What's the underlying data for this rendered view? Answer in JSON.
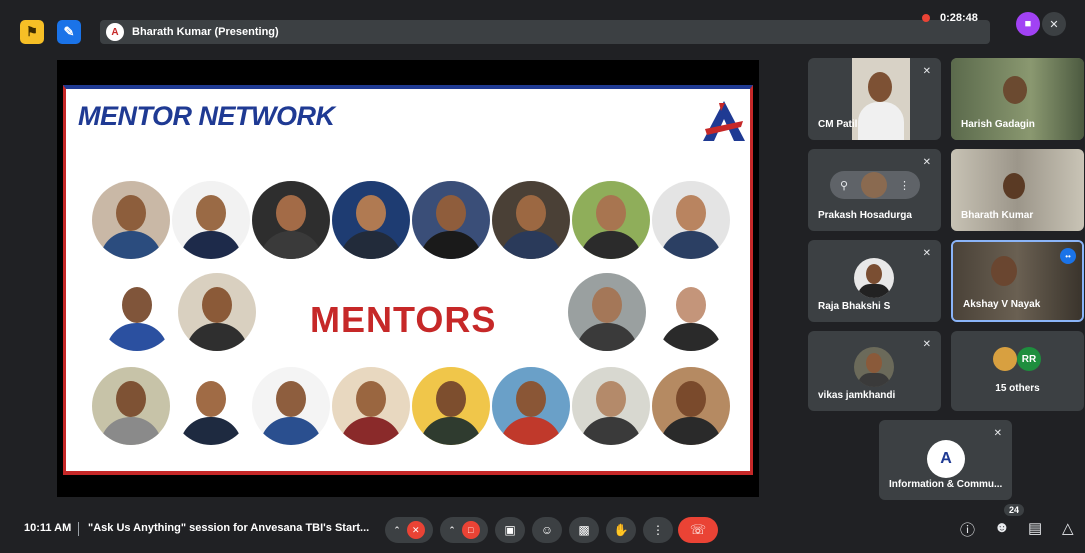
{
  "topbar": {
    "presenter_label": "Bharath Kumar (Presenting)",
    "presenter_avatar_letter": "A",
    "recording_time": "0:28:48"
  },
  "slide": {
    "title": "MENTOR NETWORK",
    "center_text": "MENTORS",
    "title_color": "#1f3a93",
    "accent_color": "#c62828"
  },
  "participants": {
    "tiles": [
      {
        "name": "CM Patil"
      },
      {
        "name": "Harish Gadagin"
      },
      {
        "name": "Prakash Hosadurga"
      },
      {
        "name": "Bharath Kumar"
      },
      {
        "name": "Raja Bhakshi S"
      },
      {
        "name": "Akshay V Nayak"
      },
      {
        "name": "vikas jamkhandi"
      },
      {
        "name": "15 others",
        "avatar_initials": "RR"
      },
      {
        "name": "Information & Commu...",
        "avatar_letter": "A"
      }
    ]
  },
  "bottombar": {
    "time": "10:11 AM",
    "meeting_title": "\"Ask Us Anything\" session for Anvesana TBI's Start...",
    "participant_count": "24"
  },
  "colors": {
    "background": "#202124",
    "tile": "#3c4043",
    "end_call": "#ea4335",
    "speaking": "#8ab4f8"
  }
}
